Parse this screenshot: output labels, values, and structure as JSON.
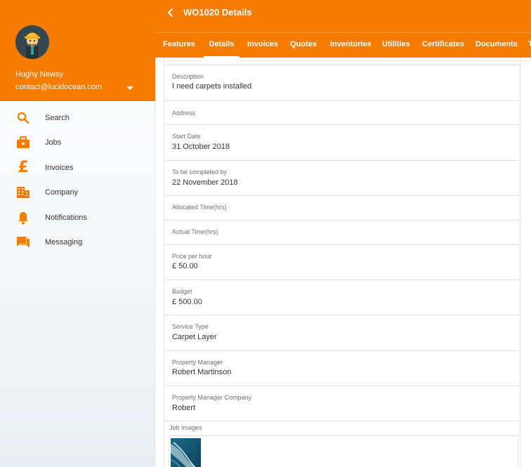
{
  "user": {
    "name": "Hughy Newsy",
    "email": "contact@lucidocean.com"
  },
  "nav": {
    "items": [
      {
        "label": "Search",
        "icon": "search-icon"
      },
      {
        "label": "Jobs",
        "icon": "briefcase-icon"
      },
      {
        "label": "Invoices",
        "icon": "pound-icon"
      },
      {
        "label": "Company",
        "icon": "building-icon"
      },
      {
        "label": "Notifications",
        "icon": "bell-icon"
      },
      {
        "label": "Messaging",
        "icon": "chat-icon"
      }
    ]
  },
  "header": {
    "title": "WO1020 Details"
  },
  "tabs": [
    {
      "label": "Features"
    },
    {
      "label": "Details",
      "active": true
    },
    {
      "label": "Invoices"
    },
    {
      "label": "Quotes"
    },
    {
      "label": "Inventories"
    },
    {
      "label": "Utilities"
    },
    {
      "label": "Certificates"
    },
    {
      "label": "Documents"
    },
    {
      "label": "T"
    }
  ],
  "details": {
    "description": {
      "label": "Description",
      "value": "I need carpets installed"
    },
    "address": {
      "label": "Address",
      "value": ""
    },
    "start_date": {
      "label": "Start Date",
      "value": "31 October 2018"
    },
    "complete_by": {
      "label": "To be completed by",
      "value": "22 November 2018"
    },
    "allocated_time": {
      "label": "Allocated Time(hrs)",
      "value": ""
    },
    "actual_time": {
      "label": "Actual Time(hrs)",
      "value": ""
    },
    "price_per_hour": {
      "label": "Price per hour",
      "value": "£ 50.00"
    },
    "budget": {
      "label": "Budget",
      "value": "£ 500.00"
    },
    "service_type": {
      "label": "Service Type",
      "value": "Carpet Layer"
    },
    "property_manager": {
      "label": "Property Manager",
      "value": "Robert Martinson"
    },
    "property_manager_company": {
      "label": "Property Manager Company",
      "value": "Robert"
    }
  },
  "job_images": {
    "label": "Job Images"
  },
  "colors": {
    "accent": "#f57c00"
  }
}
